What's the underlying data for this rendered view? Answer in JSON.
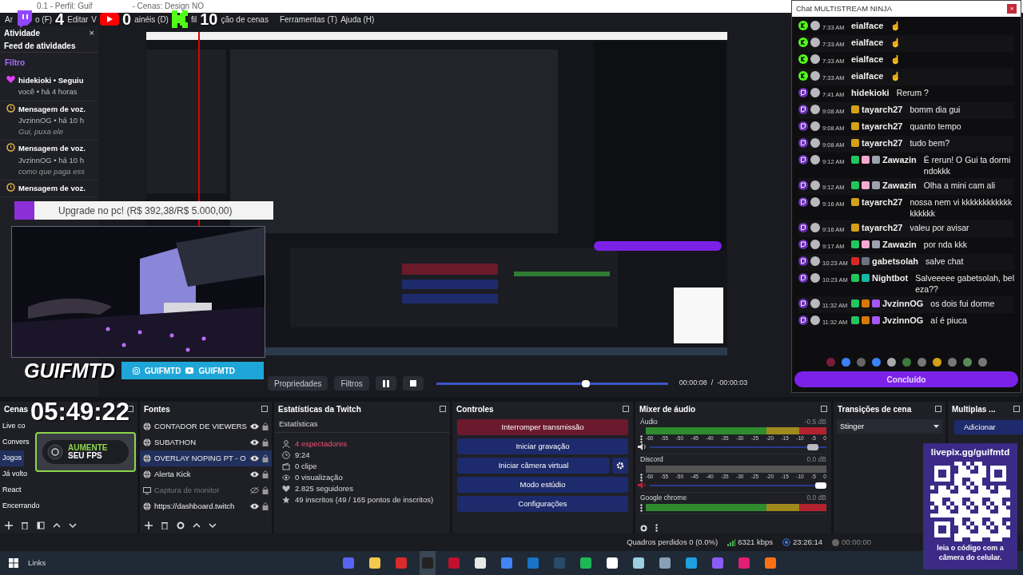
{
  "window": {
    "title": "0.1 - Perfil: Guif",
    "title_tail": "- Cenas: Design NO"
  },
  "menu": [
    "Ar",
    "o (F)",
    "Editar",
    "V",
    "ainéis (D)",
    "fil",
    "ção de cenas",
    "Ferramentas (T)",
    "Ajuda (H)"
  ],
  "activity": {
    "title": "Atividade",
    "close": "×",
    "subtitle": "Feed de atividades",
    "filter": "Filtro",
    "items": [
      {
        "kind": "follow",
        "title": "hidekioki • Seguiu",
        "meta": "você • há 4 horas"
      },
      {
        "kind": "voice",
        "title": "Mensagem de voz.",
        "meta": "JvzinnOG • há 10 h",
        "note": "Gui, puxa ele"
      },
      {
        "kind": "voice",
        "title": "Mensagem de voz.",
        "meta": "JvzinnOG • há 10 h",
        "note": "como que paga ess"
      },
      {
        "kind": "voice",
        "title": "Mensagem de voz."
      }
    ]
  },
  "preview_controls": {
    "buttons": [
      "Propriedades",
      "Filtros"
    ],
    "seek": {
      "level": 0.63
    },
    "time": "00:00:08  /  -00:00:03"
  },
  "scenes": {
    "title": "Cenas",
    "items": [
      {
        "label": "Live co",
        "selected": false
      },
      {
        "label": "Convers",
        "selected": false
      },
      {
        "label": "Jogos",
        "selected": true
      },
      {
        "label": "Já volto",
        "selected": false
      },
      {
        "label": "React",
        "selected": false
      },
      {
        "label": "Encerrando",
        "selected": false
      }
    ]
  },
  "sources": {
    "title": "Fontes",
    "items": [
      {
        "label": "CONTADOR DE VIEWERS",
        "kind": "browser",
        "visible": true,
        "selected": false
      },
      {
        "label": "SUBATHON",
        "kind": "browser",
        "visible": true,
        "selected": false
      },
      {
        "label": "OVERLAY NOPING PT - O",
        "kind": "browser",
        "visible": true,
        "selected": true
      },
      {
        "label": "Alerta Kick",
        "kind": "browser",
        "visible": true,
        "selected": false
      },
      {
        "label": "Captura de monitor",
        "kind": "display",
        "visible": false,
        "selected": false
      },
      {
        "label": "https://dashboard.twitch",
        "kind": "browser",
        "visible": true,
        "selected": false
      }
    ]
  },
  "stats": {
    "title": "Estatísticas da Twitch",
    "heading": "Estatísticas",
    "items": [
      {
        "text": "4 espectadores",
        "alert": true
      },
      {
        "text": "9:24",
        "alert": false
      },
      {
        "text": "0 clipe",
        "alert": false
      },
      {
        "text": "0 visualização",
        "alert": false
      },
      {
        "text": "2.825 seguidores",
        "alert": false
      },
      {
        "text": "49 inscritos (49 / 165 pontos de inscritos)",
        "alert": false
      }
    ]
  },
  "controls": {
    "title": "Controles",
    "buttons": [
      {
        "label": "Interromper transmissão",
        "kind": "stop",
        "settings": false
      },
      {
        "label": "Iniciar gravação",
        "kind": "normal",
        "settings": false
      },
      {
        "label": "Iniciar câmera virtual",
        "kind": "normal",
        "settings": true
      },
      {
        "label": "Modo estúdio",
        "kind": "normal",
        "settings": false
      },
      {
        "label": "Configurações",
        "kind": "normal",
        "settings": false
      }
    ]
  },
  "mixer": {
    "title": "Mixer de áudio",
    "channels": [
      {
        "name": "Áudio",
        "reading": "-0.5 dB",
        "muted": false,
        "level": 0.95,
        "scale": [
          "-60",
          "-55",
          "-50",
          "-45",
          "-40",
          "-35",
          "-30",
          "-25",
          "-20",
          "-15",
          "-10",
          "-5",
          "0"
        ]
      },
      {
        "name": "Discord",
        "reading": "0.0 dB",
        "muted": true,
        "level": 1.0,
        "scale": [
          "-60",
          "-55",
          "-50",
          "-45",
          "-40",
          "-35",
          "-30",
          "-25",
          "-20",
          "-15",
          "-10",
          "-5",
          "0"
        ]
      },
      {
        "name": "Google chrome",
        "reading": "0.0 dB"
      }
    ]
  },
  "transitions": {
    "title": "Transições de cena",
    "value": "Stinger"
  },
  "multi": {
    "title": "Multiplas ...",
    "button": "Adicionar"
  },
  "status_bar": {
    "dropped": "Quadros perdidos 0 (0.0%)",
    "bitrate": "6321 kbps",
    "live_time": "23:26:14",
    "rec_time": "00:00:00"
  },
  "taskbar": {
    "label": "Links",
    "apps": [
      {
        "color": "#5865f2",
        "active": false
      },
      {
        "color": "#f2c94c",
        "active": false
      },
      {
        "color": "#d92b2b",
        "active": false
      },
      {
        "color": "#222222",
        "active": true
      },
      {
        "color": "#c0102c",
        "active": false
      },
      {
        "color": "#e8e8e8",
        "active": false
      },
      {
        "color": "#4285f4",
        "active": false
      },
      {
        "color": "#1a73c8",
        "active": false
      },
      {
        "color": "#2a4a6b",
        "active": false
      },
      {
        "color": "#1db954",
        "active": false
      },
      {
        "color": "#ffffff",
        "active": false
      },
      {
        "color": "#9ad0e0",
        "active": false
      },
      {
        "color": "#8aa0b8",
        "active": false
      },
      {
        "color": "#1fa0e0",
        "active": false
      },
      {
        "color": "#8b5cf6",
        "active": false
      },
      {
        "color": "#e11d74",
        "active": false
      },
      {
        "color": "#f97316",
        "active": false
      }
    ]
  },
  "chat": {
    "title": "Chat MULTISTREAM NINJA",
    "close": "×",
    "done": "Concluído",
    "messages": [
      {
        "kind": "kick",
        "time": "7:33 AM",
        "user": "eialface",
        "text": "☝"
      },
      {
        "kind": "kick",
        "time": "7:33 AM",
        "user": "eialface",
        "text": "☝"
      },
      {
        "kind": "kick",
        "time": "7:33 AM",
        "user": "eialface",
        "text": "☝"
      },
      {
        "kind": "kick",
        "time": "7:33 AM",
        "user": "eialface",
        "text": "☝"
      },
      {
        "kind": "twitch",
        "time": "7:41 AM",
        "user": "hidekioki",
        "text": "Rerum ?"
      },
      {
        "kind": "twitch",
        "time": "9:08 AM",
        "user": "tayarch27",
        "text": "bomm dia gui",
        "badges": [
          {
            "color": "#d4a017"
          }
        ]
      },
      {
        "kind": "twitch",
        "time": "9:08 AM",
        "user": "tayarch27",
        "text": "quanto tempo",
        "badges": [
          {
            "color": "#d4a017"
          }
        ]
      },
      {
        "kind": "twitch",
        "time": "9:08 AM",
        "user": "tayarch27",
        "text": "tudo bem?",
        "badges": [
          {
            "color": "#d4a017"
          }
        ]
      },
      {
        "kind": "twitch",
        "time": "9:12 AM",
        "user": "Zawazin",
        "text": "É rerun! O Gui ta dormindokkk",
        "badges": [
          {
            "color": "#22c55e"
          },
          {
            "color": "#f9a8d4"
          },
          {
            "color": "#9ca3af"
          }
        ]
      },
      {
        "kind": "twitch",
        "time": "9:12 AM",
        "user": "Zawazin",
        "text": "Olha a mini cam ali",
        "badges": [
          {
            "color": "#22c55e"
          },
          {
            "color": "#f9a8d4"
          },
          {
            "color": "#9ca3af"
          }
        ]
      },
      {
        "kind": "twitch",
        "time": "9:16 AM",
        "user": "tayarch27",
        "text": "nossa nem vi kkkkkkkkkkkkkkkkkk",
        "badges": [
          {
            "color": "#d4a017"
          }
        ]
      },
      {
        "kind": "twitch",
        "time": "9:16 AM",
        "user": "tayarch27",
        "text": "valeu por avisar",
        "badges": [
          {
            "color": "#d4a017"
          }
        ]
      },
      {
        "kind": "twitch",
        "time": "9:17 AM",
        "user": "Zawazin",
        "text": "por nda kkk",
        "badges": [
          {
            "color": "#22c55e"
          },
          {
            "color": "#f9a8d4"
          },
          {
            "color": "#9ca3af"
          }
        ]
      },
      {
        "kind": "twitch",
        "time": "10:23 AM",
        "user": "gabetsolah",
        "text": "salve chat",
        "badges": [
          {
            "color": "#dc2626"
          },
          {
            "color": "#6b7280"
          }
        ]
      },
      {
        "kind": "twitch",
        "time": "10:23 AM",
        "user": "Nightbot",
        "text": "Salveeeee gabetsolah, beleza??",
        "badges": [
          {
            "color": "#22c55e"
          },
          {
            "color": "#14b8a6"
          }
        ]
      },
      {
        "kind": "twitch",
        "time": "11:32 AM",
        "user": "JvzinnOG",
        "text": "os dois fui dorme",
        "badges": [
          {
            "color": "#22c55e"
          },
          {
            "color": "#d97706"
          },
          {
            "color": "#a855f7"
          }
        ]
      },
      {
        "kind": "twitch",
        "time": "11:32 AM",
        "user": "JvzinnOG",
        "text": "aí é piuca",
        "badges": [
          {
            "color": "#22c55e"
          },
          {
            "color": "#d97706"
          },
          {
            "color": "#a855f7"
          }
        ]
      }
    ]
  },
  "overlay": {
    "counters": [
      {
        "kind": "twitch",
        "count": "4"
      },
      {
        "kind": "youtube",
        "count": "0"
      },
      {
        "kind": "kick",
        "count": "10"
      }
    ],
    "goal": "Upgrade no pc! (R$ 392,38/R$ 5.000,00)",
    "logo": "GUIFMTD",
    "socials": [
      {
        "kind": "instagram",
        "handle": "GUIFMTD"
      },
      {
        "kind": "youtube",
        "handle": "GUIFMTD"
      }
    ],
    "timer": "05:49:22",
    "fps_line1": "AUMENTE",
    "fps_line2": "SEU FPS",
    "qr_title": "livepix.gg/guifmtd",
    "qr_caption": "leia o código com a câmera do celular."
  }
}
